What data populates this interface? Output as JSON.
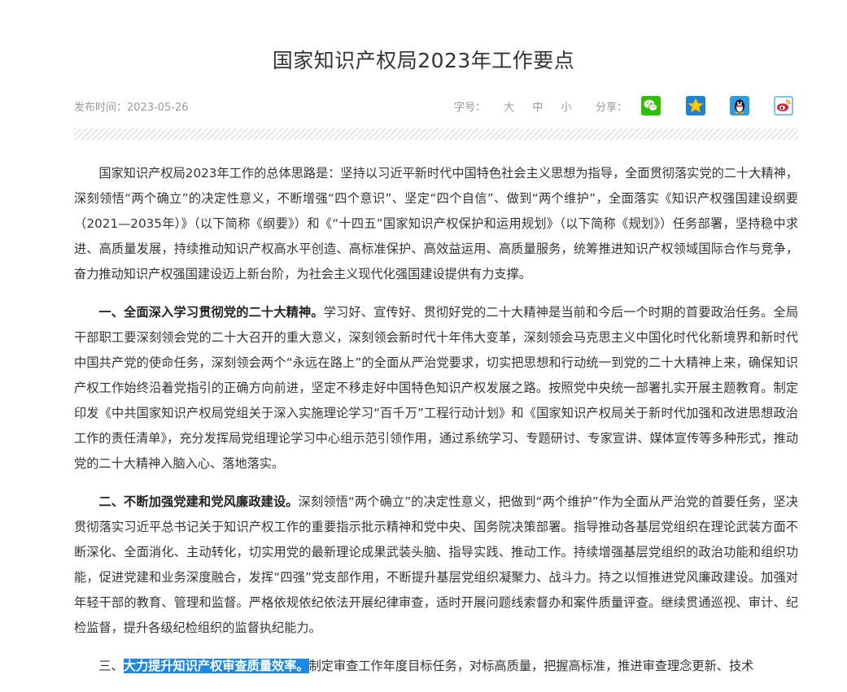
{
  "article": {
    "title": "国家知识产权局2023年工作要点",
    "publish_time": "发布时间：2023-05-26",
    "font_size_label": "字号：",
    "font_sizes": [
      "大",
      "中",
      "小"
    ],
    "share_label": "分享：",
    "share_icons": [
      "wechat-icon",
      "qzone-star-icon",
      "qq-penguin-icon",
      "weibo-icon"
    ],
    "colors": {
      "wechat": "#2dc100",
      "qzone": "#1a82d9",
      "qq": "#2f9be0",
      "weibo": "#e6162d",
      "selection": "#1e88e5"
    },
    "paragraphs": [
      {
        "head": "",
        "body": "国家知识产权局2023年工作的总体思路是：坚持以习近平新时代中国特色社会主义思想为指导，全面贯彻落实党的二十大精神，深刻领悟“两个确立”的决定性意义，不断增强“四个意识”、坚定“四个自信”、做到“两个维护”，全面落实《知识产权强国建设纲要（2021—2035年）》（以下简称《纲要》）和《“十四五”国家知识产权保护和运用规划》（以下简称《规划》）任务部署，坚持稳中求进、高质量发展，持续推动知识产权高水平创造、高标准保护、高效益运用、高质量服务，统筹推进知识产权领域国际合作与竞争，奋力推动知识产权强国建设迈上新台阶，为社会主义现代化强国建设提供有力支撑。"
      },
      {
        "head": "一、全面深入学习贯彻党的二十大精神。",
        "body": "学习好、宣传好、贯彻好党的二十大精神是当前和今后一个时期的首要政治任务。全局干部职工要深刻领会党的二十大召开的重大意义，深刻领会新时代十年伟大变革，深刻领会马克思主义中国化时代化新境界和新时代中国共产党的使命任务，深刻领会两个“永远在路上”的全面从严治党要求，切实把思想和行动统一到党的二十大精神上来，确保知识产权工作始终沿着党指引的正确方向前进，坚定不移走好中国特色知识产权发展之路。按照党中央统一部署扎实开展主题教育。制定印发《中共国家知识产权局党组关于深入实施理论学习“百千万”工程行动计划》和《国家知识产权局关于新时代加强和改进思想政治工作的责任清单》，充分发挥局党组理论学习中心组示范引领作用，通过系统学习、专题研讨、专家宣讲、媒体宣传等多种形式，推动党的二十大精神入脑入心、落地落实。"
      },
      {
        "head": "二、不断加强党建和党风廉政建设。",
        "body": "深刻领悟“两个确立”的决定性意义，把做到“两个维护”作为全面从严治党的首要任务，坚决贯彻落实习近平总书记关于知识产权工作的重要指示批示精神和党中央、国务院决策部署。指导推动各基层党组织在理论武装方面不断深化、全面消化、主动转化，切实用党的最新理论成果武装头脑、指导实践、推动工作。持续增强基层党组织的政治功能和组织功能，促进党建和业务深度融合，发挥“四强”党支部作用，不断提升基层党组织凝聚力、战斗力。持之以恒推进党风廉政建设。加强对年轻干部的教育、管理和监督。严格依规依纪依法开展纪律审查，适时开展问题线索督办和案件质量评查。继续贯通巡视、审计、纪检监督，提升各级纪检组织的监督执纪能力。"
      },
      {
        "head_prefix": "三、",
        "head": "大力提升知识产权审查质量效率。",
        "body": "制定审查工作年度目标任务，对标高质量，把握高标准，推进审查理念更新、技术"
      }
    ]
  }
}
